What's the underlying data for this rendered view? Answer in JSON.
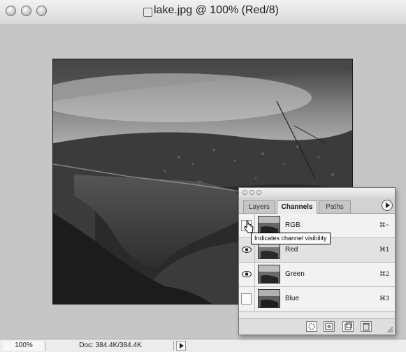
{
  "window": {
    "title": "lake.jpg @ 100% (Red/8)"
  },
  "statusbar": {
    "zoom": "100%",
    "doc_info": "Doc: 384.4K/384.4K"
  },
  "palette": {
    "tabs": [
      "Layers",
      "Channels",
      "Paths"
    ],
    "active_tab": "Channels",
    "channels": [
      {
        "name": "RGB",
        "shortcut": "⌘~",
        "visible": false
      },
      {
        "name": "Red",
        "shortcut": "⌘1",
        "visible": true
      },
      {
        "name": "Green",
        "shortcut": "⌘2",
        "visible": true
      },
      {
        "name": "Blue",
        "shortcut": "⌘3",
        "visible": false
      }
    ],
    "bottom_icons": [
      "load-channel-as-selection-icon",
      "save-selection-as-channel-icon",
      "new-channel-icon",
      "trash-icon"
    ]
  },
  "tooltip": {
    "text": "Indicates channel visibility"
  }
}
